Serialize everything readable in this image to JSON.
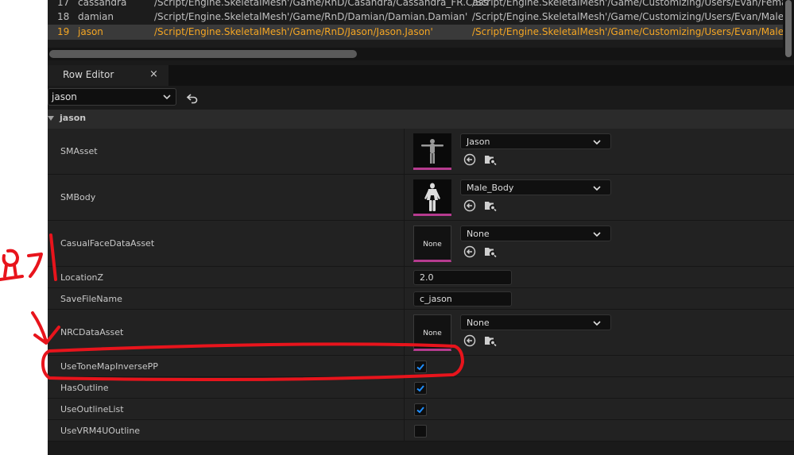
{
  "data_table": {
    "rows": [
      {
        "num": "17",
        "name": "cassandra",
        "col1": "/Script/Engine.SkeletalMesh'/Game/RnD/Casandra/Cassandra_FR.Cass",
        "col2": "/Script/Engine.SkeletalMesh'/Game/Customizing/Users/Evan/Female_Bo"
      },
      {
        "num": "18",
        "name": "damian",
        "col1": "/Script/Engine.SkeletalMesh'/Game/RnD/Damian/Damian.Damian'",
        "col2": "/Script/Engine.SkeletalMesh'/Game/Customizing/Users/Evan/Male_Boc"
      },
      {
        "num": "19",
        "name": "jason",
        "col1": "/Script/Engine.SkeletalMesh'/Game/RnD/Jason/Jason.Jason'",
        "col2": "/Script/Engine.SkeletalMesh'/Game/Customizing/Users/Evan/Male_Boc"
      }
    ],
    "selected_row": "19"
  },
  "row_editor": {
    "tab_label": "Row Editor",
    "close_glyph": "×",
    "row_select_value": "jason",
    "section_title": "jason"
  },
  "properties": {
    "smasset": {
      "label": "SMAsset",
      "value": "Jason"
    },
    "smbody": {
      "label": "SMBody",
      "value": "Male_Body"
    },
    "casualface": {
      "label": "CasualFaceDataAsset",
      "value": "None",
      "thumb_text": "None"
    },
    "locationz": {
      "label": "LocationZ",
      "value": "2.0"
    },
    "savefilename": {
      "label": "SaveFileName",
      "value": "c_jason"
    },
    "nrcdataasset": {
      "label": "NRCDataAsset",
      "value": "None",
      "thumb_text": "None"
    },
    "usetonemap": {
      "label": "UseToneMapInversePP",
      "checked": true
    },
    "hasoutline": {
      "label": "HasOutline",
      "checked": true
    },
    "useoutlinelist": {
      "label": "UseOutlineList",
      "checked": true
    },
    "usevrm4u": {
      "label": "UseVRM4UOutline",
      "checked": false
    }
  },
  "annotation": {
    "handwritten_text": "요기"
  },
  "colors": {
    "selected_row_text": "#f5a623",
    "asset_underline": "#b63b8f",
    "checkbox_tick": "#1f8fff",
    "annotation_red": "#e8141c"
  }
}
